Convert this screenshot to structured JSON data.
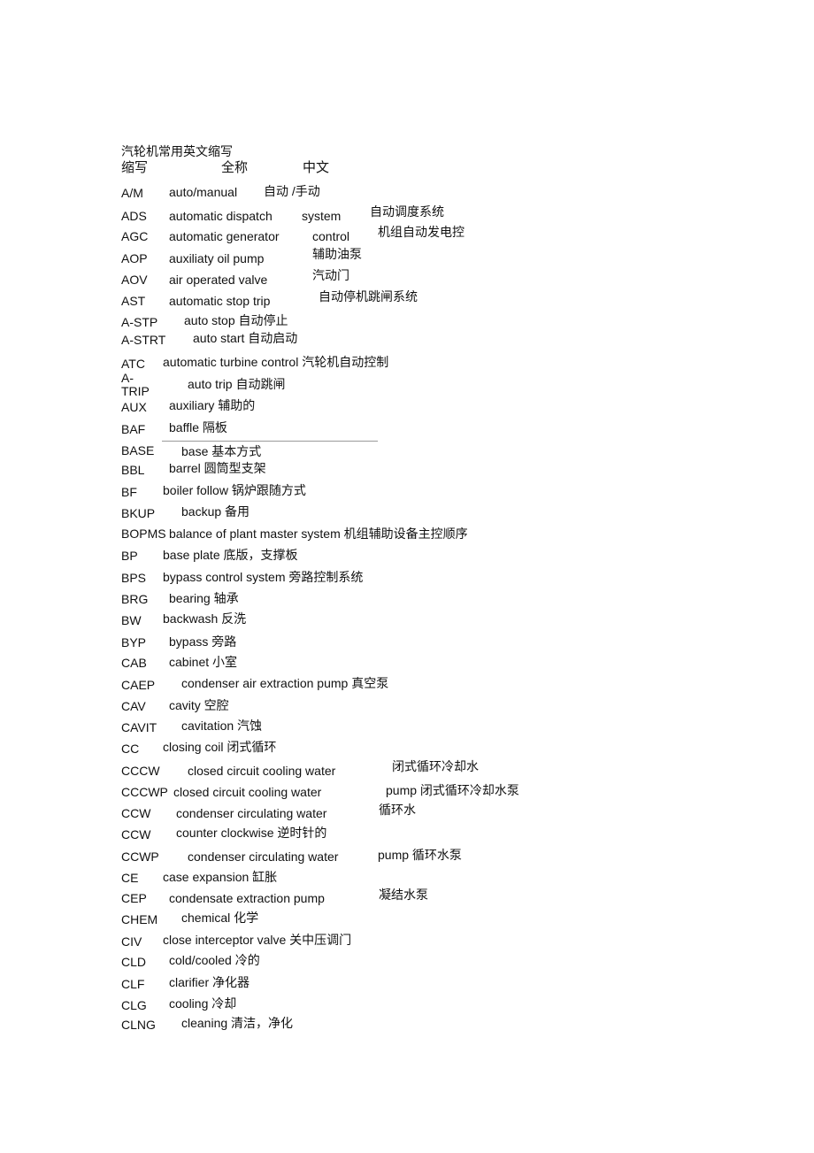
{
  "document": {
    "title": "汽轮机常用英文缩写",
    "headers": {
      "abbr": "缩写",
      "full": "全称",
      "chinese": "中文"
    },
    "rows": [
      {
        "abbr": "A/M",
        "parts": [
          "auto/manual",
          "自动 /手动"
        ]
      },
      {
        "abbr": "ADS",
        "parts": [
          "automatic dispatch",
          "system",
          "自动调度系统"
        ]
      },
      {
        "abbr": "AGC",
        "parts": [
          "automatic generator",
          "control",
          "机组自动发电控"
        ]
      },
      {
        "abbr": "AOP",
        "parts": [
          "auxiliaty oil pump",
          "辅助油泵"
        ]
      },
      {
        "abbr": "AOV",
        "parts": [
          "air operated valve",
          "汽动门"
        ]
      },
      {
        "abbr": "AST",
        "parts": [
          "automatic stop trip",
          "自动停机跳闸系统"
        ]
      },
      {
        "abbr": "A-STP",
        "parts": [
          "auto stop 自动停止"
        ]
      },
      {
        "abbr": "A-STRT",
        "parts": [
          "auto start 自动启动"
        ]
      },
      {
        "abbr": "ATC",
        "parts": [
          "automatic turbine control 汽轮机自动控制"
        ]
      },
      {
        "abbr": "A-TRIP",
        "parts": [
          "auto trip 自动跳闸"
        ]
      },
      {
        "abbr": "AUX",
        "parts": [
          "auxiliary 辅助的"
        ]
      },
      {
        "abbr": "BAF",
        "parts": [
          "baffle 隔板"
        ]
      },
      {
        "abbr": "BASE",
        "parts": [
          "base 基本方式"
        ]
      },
      {
        "abbr": "BBL",
        "parts": [
          "barrel 圆筒型支架"
        ]
      },
      {
        "abbr": "BF",
        "parts": [
          "boiler follow 锅炉跟随方式"
        ]
      },
      {
        "abbr": "BKUP",
        "parts": [
          "backup 备用"
        ]
      },
      {
        "abbr": "BOPMS",
        "parts": [
          "balance of plant master system 机组辅助设备主控顺序"
        ]
      },
      {
        "abbr": "BP",
        "parts": [
          "base plate 底版，支撑板"
        ]
      },
      {
        "abbr": "BPS",
        "parts": [
          "bypass control system 旁路控制系统"
        ]
      },
      {
        "abbr": "BRG",
        "parts": [
          "bearing 轴承"
        ]
      },
      {
        "abbr": "BW",
        "parts": [
          "backwash 反洗"
        ]
      },
      {
        "abbr": "BYP",
        "parts": [
          "bypass 旁路"
        ]
      },
      {
        "abbr": "CAB",
        "parts": [
          "cabinet 小室"
        ]
      },
      {
        "abbr": "CAEP",
        "parts": [
          "condenser air extraction pump 真空泵"
        ]
      },
      {
        "abbr": "CAV",
        "parts": [
          "cavity 空腔"
        ]
      },
      {
        "abbr": "CAVIT",
        "parts": [
          "cavitation 汽蚀"
        ]
      },
      {
        "abbr": "CC",
        "parts": [
          "closing coil 闭式循环"
        ]
      },
      {
        "abbr": "CCCW",
        "parts": [
          "closed circuit cooling water",
          "闭式循环冷却水"
        ]
      },
      {
        "abbr": "CCCWP",
        "parts": [
          "closed circuit cooling water",
          "pump 闭式循环冷却水泵"
        ]
      },
      {
        "abbr": "CCW",
        "parts": [
          "condenser circulating water",
          "循环水"
        ]
      },
      {
        "abbr": "CCW",
        "parts": [
          "counter clockwise 逆时针的"
        ]
      },
      {
        "abbr": "CCWP",
        "parts": [
          "condenser circulating water",
          "pump 循环水泵"
        ]
      },
      {
        "abbr": "CE",
        "parts": [
          "case expansion 缸胀"
        ]
      },
      {
        "abbr": "CEP",
        "parts": [
          "condensate extraction pump",
          "凝结水泵"
        ]
      },
      {
        "abbr": "CHEM",
        "parts": [
          "chemical 化学"
        ]
      },
      {
        "abbr": "CIV",
        "parts": [
          "close interceptor valve 关中压调门"
        ]
      },
      {
        "abbr": "CLD",
        "parts": [
          "cold/cooled 冷的"
        ]
      },
      {
        "abbr": "CLF",
        "parts": [
          "clarifier 净化器"
        ]
      },
      {
        "abbr": "CLG",
        "parts": [
          "cooling 冷却"
        ]
      },
      {
        "abbr": "CLNG",
        "parts": [
          "cleaning 清洁，净化"
        ]
      }
    ]
  }
}
